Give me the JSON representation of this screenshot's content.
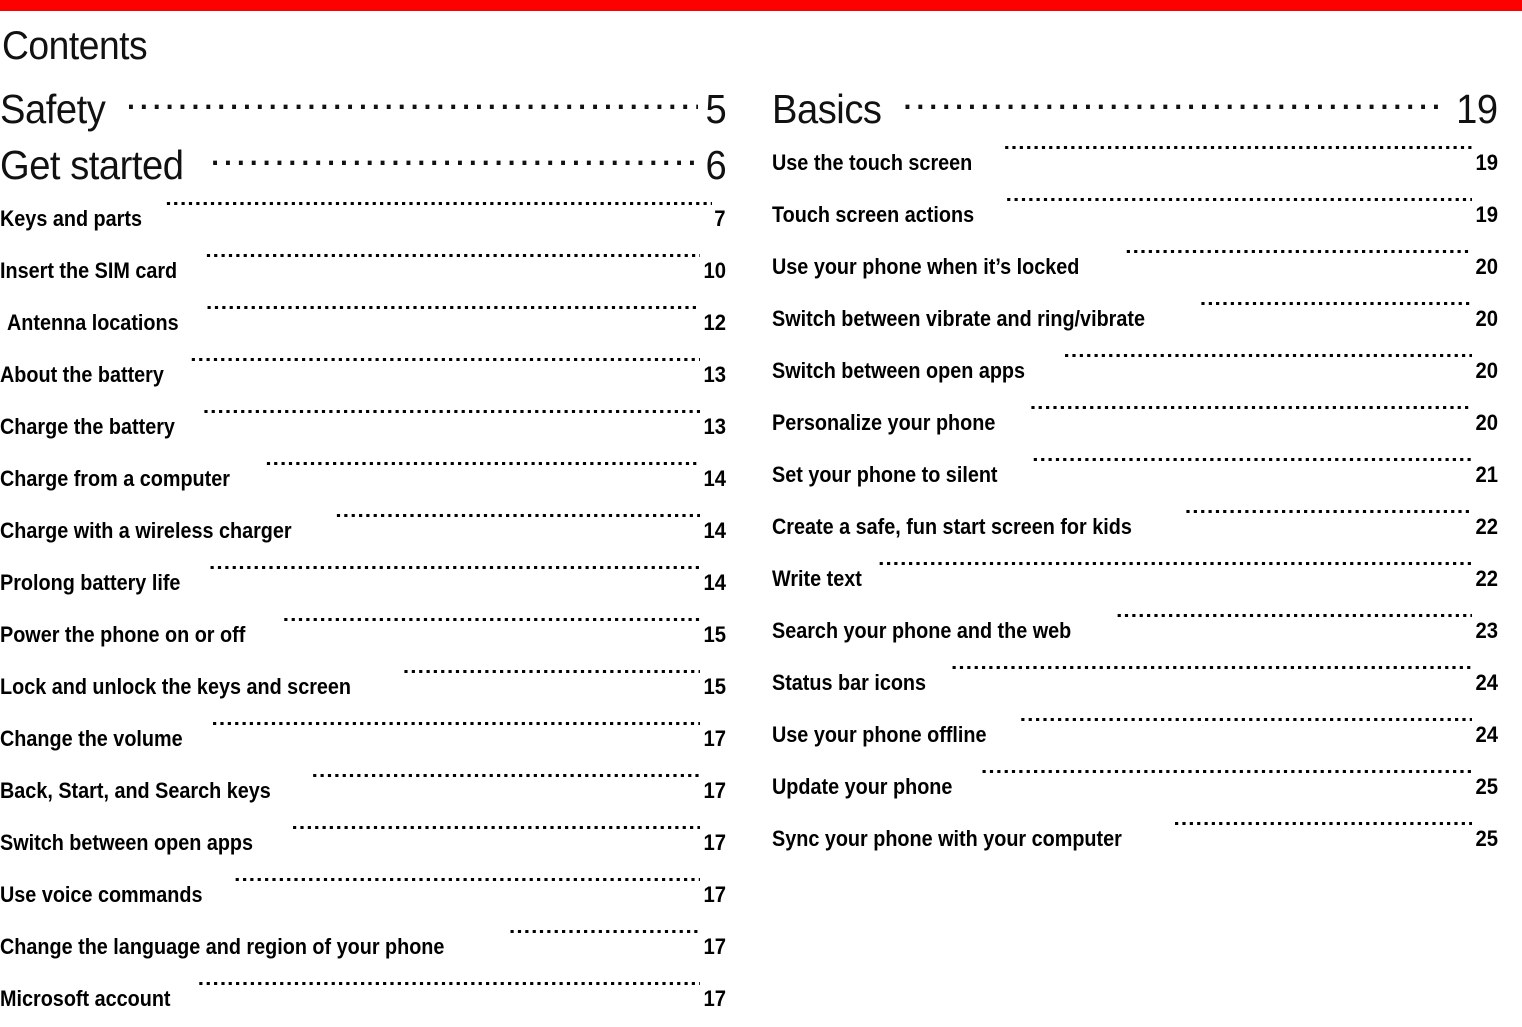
{
  "theme": {
    "accent_color": "#FF0000",
    "text_color": "#000000",
    "background_color": "#FFFFFF"
  },
  "header": {
    "title": "Contents"
  },
  "left_column": {
    "chapters": [
      {
        "label": "Safety",
        "page": "5"
      },
      {
        "label": "Get started",
        "page": "6"
      }
    ],
    "entries": [
      {
        "label": "Keys and parts",
        "page": "7"
      },
      {
        "label": "Insert the SIM card",
        "page": "10"
      },
      {
        "label": "Antenna locations",
        "page": "12"
      },
      {
        "label": "About  the  battery",
        "page": "13"
      },
      {
        "label": "Charge the battery",
        "page": "13"
      },
      {
        "label": "Charge from a computer",
        "page": "14"
      },
      {
        "label": "Charge with a wireless charger",
        "page": "14"
      },
      {
        "label": "Prolong battery life",
        "page": "14"
      },
      {
        "label": "Power the phone on or off",
        "page": "15"
      },
      {
        "label": "Lock and unlock the keys and screen",
        "page": "15"
      },
      {
        "label": "Change the volume",
        "page": "17"
      },
      {
        "label": "Back, Start, and Search keys",
        "page": "17"
      },
      {
        "label": "Switch between open apps",
        "page": "17"
      },
      {
        "label": "Use voice commands",
        "page": "17"
      },
      {
        "label": "Change the language and region of your phone",
        "page": "17"
      },
      {
        "label": "Microsoft account",
        "page": "17"
      }
    ]
  },
  "right_column": {
    "chapters": [
      {
        "label": "Basics",
        "page": "19"
      }
    ],
    "entries": [
      {
        "label": "Use the touch screen",
        "page": "19"
      },
      {
        "label": "Touch screen actions",
        "page": "19"
      },
      {
        "label": "Use your phone when it’s locked",
        "page": "20"
      },
      {
        "label": "Switch between vibrate and ring/vibrate",
        "page": "20"
      },
      {
        "label": "Switch between open apps",
        "page": "20"
      },
      {
        "label": "Personalize your phone",
        "page": "20"
      },
      {
        "label": "Set your phone to silent",
        "page": "21"
      },
      {
        "label": "Create a safe, fun start screen for kids",
        "page": "22"
      },
      {
        "label": "Write text",
        "page": "22"
      },
      {
        "label": "Search your phone and the web",
        "page": "23"
      },
      {
        "label": "Status bar icons",
        "page": "24"
      },
      {
        "label": "Use your phone offline",
        "page": "24"
      },
      {
        "label": "Update your phone",
        "page": "25"
      },
      {
        "label": "Sync your phone with your computer",
        "page": "25"
      }
    ]
  }
}
